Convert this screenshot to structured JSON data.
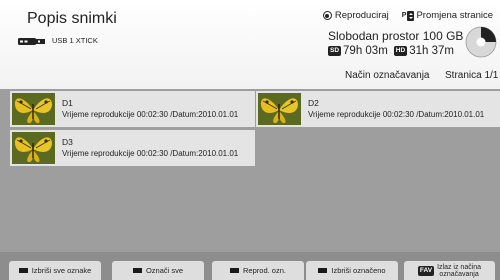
{
  "header": {
    "title": "Popis snimki",
    "source_label": "USB 1 XTICK",
    "legend_play": "Reproduciraj",
    "legend_page_change": "Promjena stranice",
    "free_space": "Slobodan prostor 100 GB",
    "sd_badge": "SD",
    "sd_time": "79h 03m",
    "hd_badge": "HD",
    "hd_time": "31h 37m",
    "disk_used_fraction": 0.25,
    "mode_label": "Način označavanja",
    "page_label": "Stranica 1/1"
  },
  "recordings": [
    {
      "name": "D1",
      "info": "Vrijeme reprodukcije 00:02:30 /Datum:2010.01.01"
    },
    {
      "name": "D2",
      "info": "Vrijeme reprodukcije 00:02:30 /Datum:2010.01.01"
    },
    {
      "name": "D3",
      "info": "Vrijeme reprodukcije 00:02:30 /Datum:2010.01.01"
    }
  ],
  "footer": {
    "buttons": [
      {
        "label": "Izbriši sve oznake",
        "key_color": "#1a1a1a"
      },
      {
        "label": "Označi sve",
        "key_color": "#1a1a1a"
      },
      {
        "label": "Reprod. ozn.",
        "key_color": "#1a1a1a"
      },
      {
        "label": "Izbriši označeno",
        "key_color": "#1a1a1a"
      }
    ],
    "fav_badge": "FAV",
    "exit_line1": "Izlaz iz načina",
    "exit_line2": "označavanja"
  },
  "colors": {
    "list_background": "#9e9e9e",
    "item_background": "#e4e4e4",
    "footer_background": "#8d8d8d"
  }
}
